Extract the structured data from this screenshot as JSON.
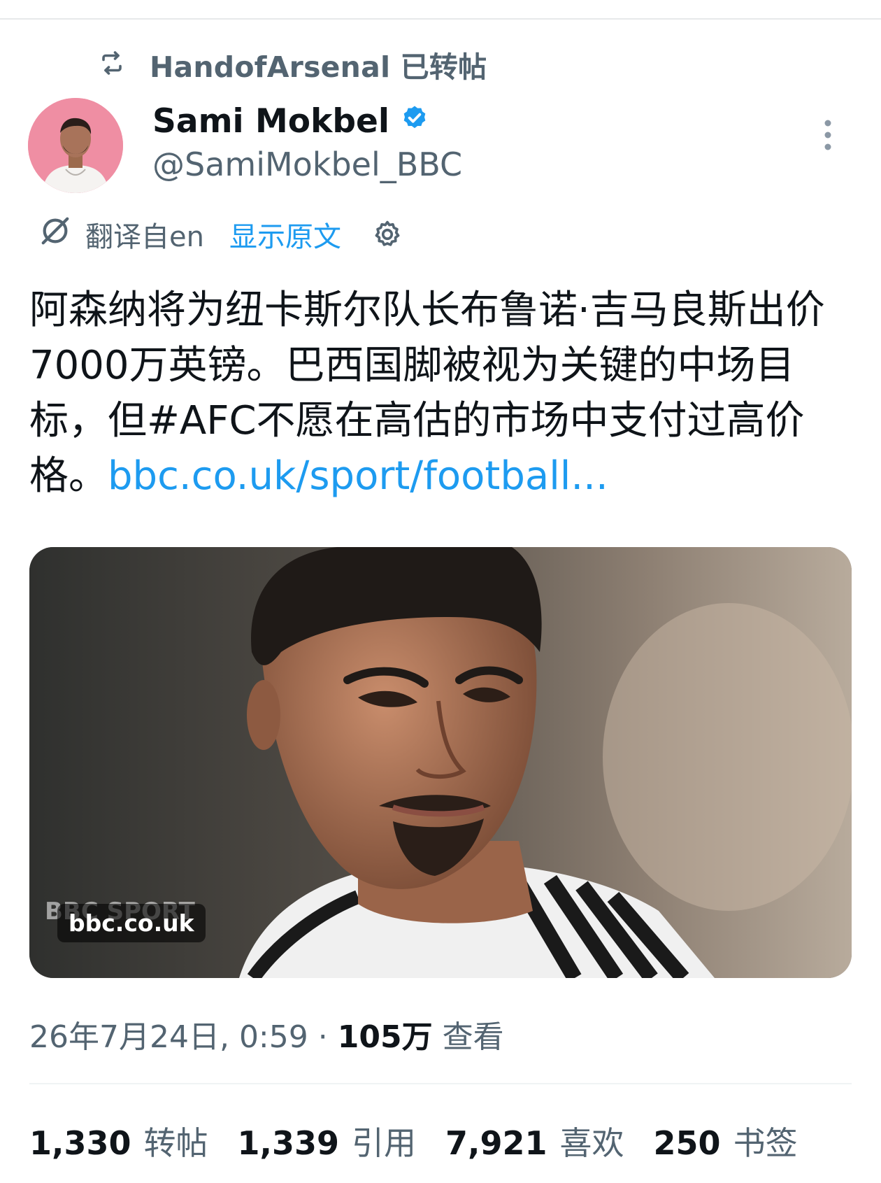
{
  "repost": {
    "text": "HandofArsenal 已转帖"
  },
  "author": {
    "name": "Sami Mokbel",
    "handle": "@SamiMokbel_BBC"
  },
  "translation": {
    "source_label": "翻译自en",
    "show_original": "显示原文"
  },
  "tweet": {
    "text": "阿森纳将为纽卡斯尔队长布鲁诺·吉马良斯出价7000万英镑。巴西国脚被视为关键的中场目标，但#AFC不愿在高估的市场中支付过高价格。",
    "link": "bbc.co.uk/sport/football..."
  },
  "media": {
    "source_chip": "bbc.co.uk",
    "watermark": "BBC SPORT"
  },
  "meta": {
    "timestamp": "26年7月24日, 0:59",
    "separator": "·",
    "views_count": "105万",
    "views_label": "查看"
  },
  "stats": [
    {
      "count": "1,330",
      "label": "转帖"
    },
    {
      "count": "1,339",
      "label": "引用"
    },
    {
      "count": "7,921",
      "label": "喜欢"
    },
    {
      "count": "250",
      "label": "书签"
    }
  ],
  "colors": {
    "accent": "#1d9bf0",
    "secondary_text": "#536471",
    "primary_text": "#0f1419",
    "verified": "#1d9bf0"
  },
  "icons": {
    "repost": "repost-icon",
    "verified": "verified-badge-icon",
    "more": "more-vertical-icon",
    "translate": "translate-icon",
    "settings": "gear-icon"
  }
}
